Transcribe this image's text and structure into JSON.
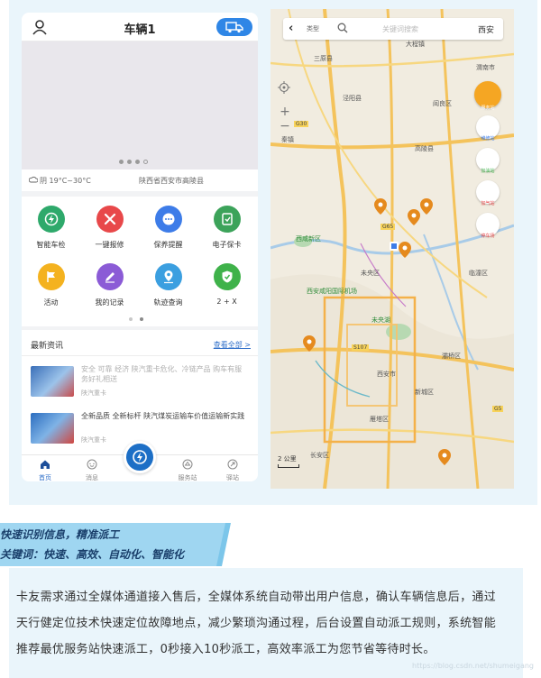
{
  "phone1": {
    "title": "车辆1",
    "weather": "阴 19°C~30°C",
    "location": "陕西省西安市高陵县",
    "grid": [
      {
        "label": "智能车检",
        "color": "#2ea96b",
        "icon": "bolt-icon"
      },
      {
        "label": "一键报修",
        "color": "#e8484a",
        "icon": "tools-icon"
      },
      {
        "label": "保养提醒",
        "color": "#3d7ce8",
        "icon": "chat-icon"
      },
      {
        "label": "电子保卡",
        "color": "#3ca35a",
        "icon": "card-icon"
      },
      {
        "label": "活动",
        "color": "#f4b21f",
        "icon": "flag-icon"
      },
      {
        "label": "我的记录",
        "color": "#8b5bd6",
        "icon": "pen-icon"
      },
      {
        "label": "轨迹查询",
        "color": "#3b9fe0",
        "icon": "pin-icon"
      },
      {
        "label": "2 + X",
        "color": "#3fb24a",
        "icon": "shield-icon"
      }
    ],
    "news_title": "最新资讯",
    "news_more": "查看全部 >",
    "news": [
      {
        "text": "安全 可靠 经济 陕汽重卡危化、冷链产品 购车有服务好礼相送",
        "source": "陕汽重卡",
        "faded": true
      },
      {
        "text": "全新品质 全新标杆 陕汽煤炭运输车价值运输新实践",
        "source": "陕汽重卡",
        "faded": false
      }
    ],
    "tabs": [
      {
        "label": "首页",
        "icon": "home-icon"
      },
      {
        "label": "消息",
        "icon": "message-icon"
      },
      {
        "label": "",
        "icon": "center-logo-icon"
      },
      {
        "label": "服务站",
        "icon": "station-icon"
      },
      {
        "label": "驿站",
        "icon": "post-icon"
      }
    ]
  },
  "map": {
    "search_type": "类型",
    "search_placeholder": "关键词搜索",
    "city": "西安",
    "side_buttons": [
      {
        "label": "服务站",
        "color": "#f5a623"
      },
      {
        "label": "维修站",
        "color": "#3d7ce8"
      },
      {
        "label": "加油站",
        "color": "#3fb24a"
      },
      {
        "label": "加气站",
        "color": "#e8484a"
      },
      {
        "label": "停车场",
        "color": "#e8484a"
      }
    ],
    "labels": [
      "三原县",
      "秦镇",
      "大程镇",
      "泾阳县",
      "高陵县",
      "阎良区",
      "渭南市",
      "临潼区",
      "西咸新区",
      "西安咸阳国际机场",
      "未央区",
      "灞桥区",
      "长安区",
      "雁塔区",
      "新城区",
      "未央湖",
      "西安市",
      "G30",
      "G65",
      "S107",
      "G5"
    ],
    "scale": "2 公里"
  },
  "section": {
    "ribbon_line1": "快速识别信息，精准派工",
    "ribbon_line2": "关键词：快速、高效、自动化、智能化",
    "description": "卡友需求通过全媒体通道接入售后，全媒体系统自动带出用户信息，确认车辆信息后，通过天行健定位技术快速定位故障地点，减少繁琐沟通过程，后台设置自动派工规则，系统智能推荐最优服务站快速派工，0秒接入10秒派工，高效率派工为您节省等待时长。",
    "watermark": "https://blog.csdn.net/shumeigang"
  }
}
